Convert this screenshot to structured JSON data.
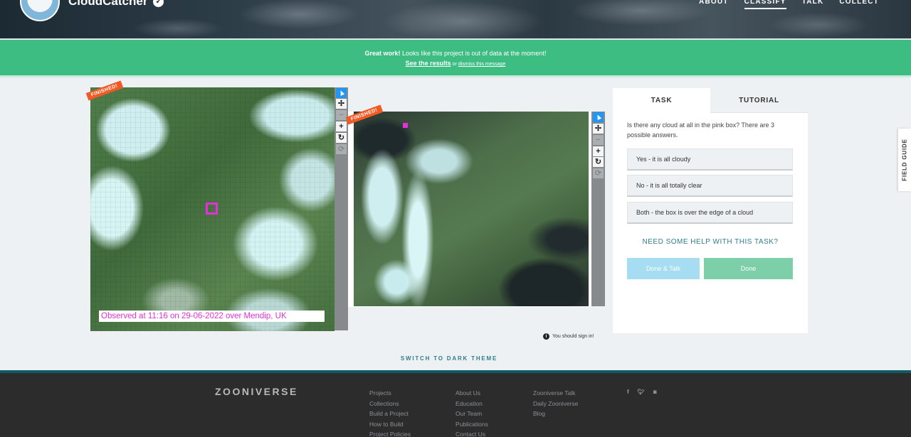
{
  "header": {
    "title": "CloudCatcher",
    "verified_icon": "check-circle-icon",
    "nav": [
      "ABOUT",
      "CLASSIFY",
      "TALK",
      "COLLECT"
    ],
    "active_nav": "CLASSIFY"
  },
  "banner": {
    "bold_text": "Great work!",
    "text": " Looks like this project is out of data at the moment!",
    "results_link": "See the results",
    "or_text": " or ",
    "dismiss_link": "dismiss this message"
  },
  "subjects": {
    "ribbon_label": "FINISHED!",
    "caption": "Observed at 11:16 on 29-06-2022 over Mendip, UK"
  },
  "toolbar": {
    "icons": [
      "pointer-icon",
      "move-icon",
      "zoom-out-icon",
      "zoom-in-icon",
      "rotate-icon",
      "reset-icon"
    ],
    "labels": [
      "",
      "✢",
      "−",
      "+",
      "↻",
      "⟳"
    ]
  },
  "task": {
    "tabs": [
      "TASK",
      "TUTORIAL"
    ],
    "question": "Is there any cloud at all in the pink box? There are 3 possible answers.",
    "answers": [
      "Yes - it is all cloudy",
      "No - it is all totally clear",
      "Both - the box is over the edge of a cloud"
    ],
    "help": "NEED SOME HELP WITH THIS TASK?",
    "done_talk": "Done & Talk",
    "done": "Done"
  },
  "field_guide": "FIELD GUIDE",
  "signin": "You should sign in!",
  "switch_theme": "SWITCH TO DARK THEME",
  "footer": {
    "logo": "ZOONIVERSE",
    "col1": [
      "Projects",
      "Collections",
      "Build a Project",
      "How to Build",
      "Project Policies"
    ],
    "col2": [
      "About Us",
      "Education",
      "Our Team",
      "Publications",
      "Contact Us"
    ],
    "col3": [
      "Zooniverse Talk",
      "Daily Zooniverse",
      "Blog"
    ],
    "social": [
      "f",
      "t",
      "ig"
    ],
    "social_icons": [
      "facebook-icon",
      "twitter-icon",
      "instagram-icon"
    ]
  }
}
